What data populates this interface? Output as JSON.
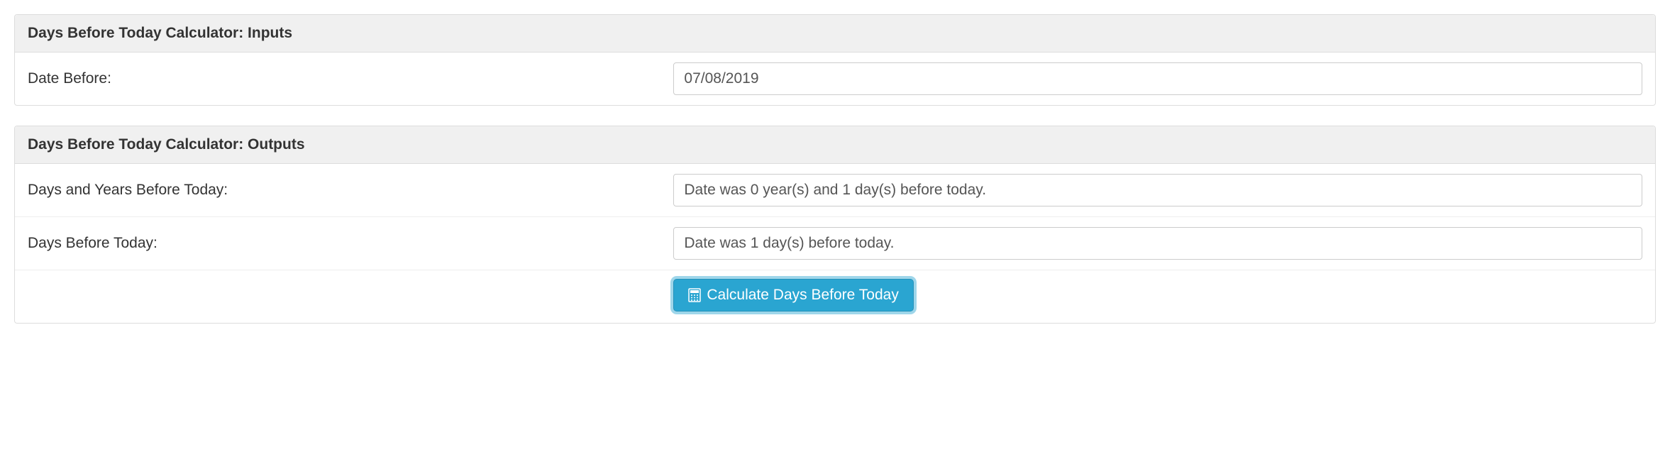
{
  "inputs": {
    "header": "Days Before Today Calculator: Inputs",
    "date_before_label": "Date Before:",
    "date_before_value": "07/08/2019"
  },
  "outputs": {
    "header": "Days Before Today Calculator: Outputs",
    "days_years_label": "Days and Years Before Today:",
    "days_years_value": "Date was 0 year(s) and 1 day(s) before today.",
    "days_before_label": "Days Before Today:",
    "days_before_value": "Date was 1 day(s) before today.",
    "calculate_button": "Calculate Days Before Today"
  }
}
